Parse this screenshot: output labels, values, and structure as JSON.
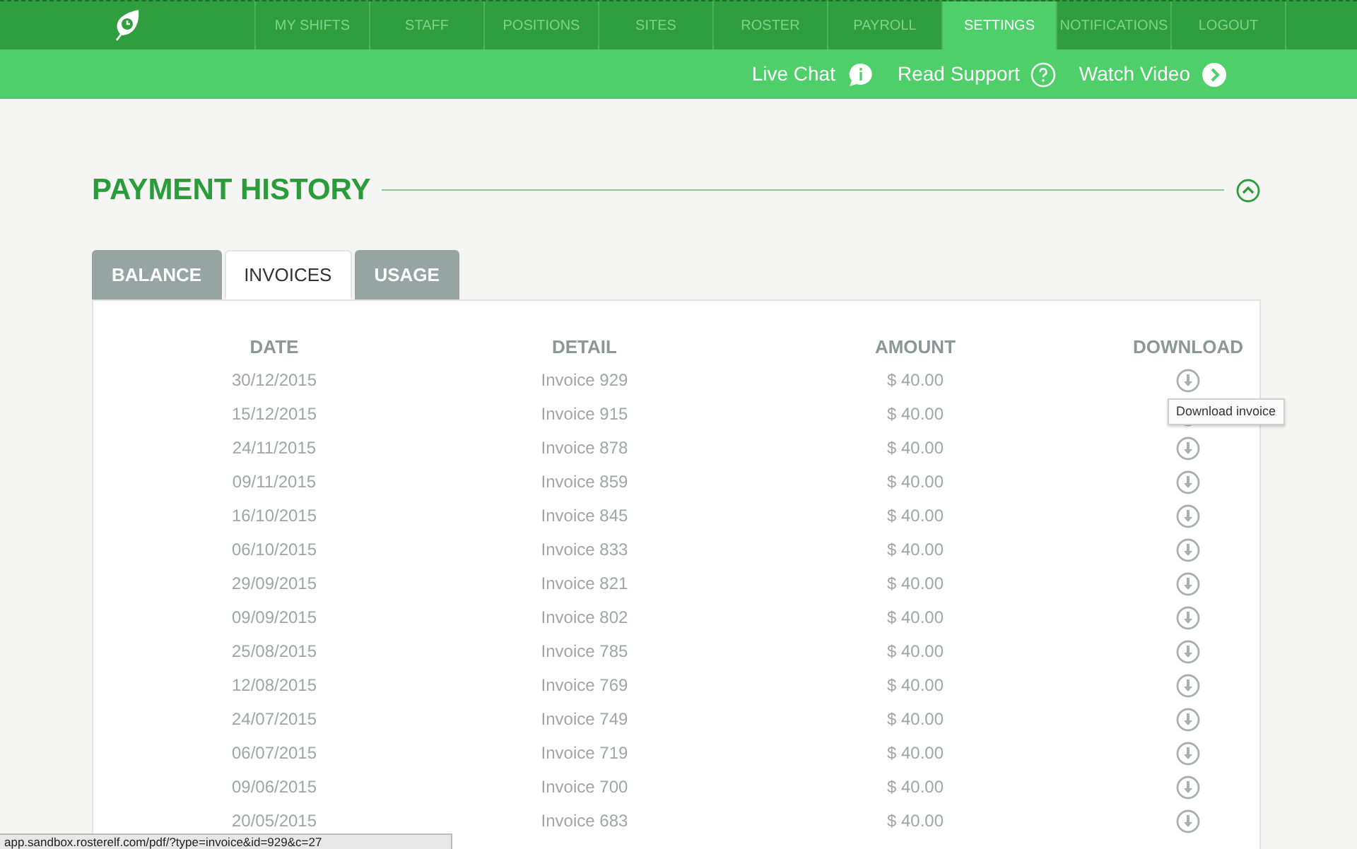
{
  "nav": {
    "items": [
      {
        "label": "MY SHIFTS",
        "selected": false
      },
      {
        "label": "STAFF",
        "selected": false
      },
      {
        "label": "POSITIONS",
        "selected": false
      },
      {
        "label": "SITES",
        "selected": false
      },
      {
        "label": "ROSTER",
        "selected": false
      },
      {
        "label": "PAYROLL",
        "selected": false
      },
      {
        "label": "SETTINGS",
        "selected": true
      },
      {
        "label": "NOTIFICATIONS",
        "selected": false
      },
      {
        "label": "LOGOUT",
        "selected": false
      }
    ]
  },
  "help_links": [
    {
      "label": "Live Chat",
      "kind": "chat"
    },
    {
      "label": "Read Support",
      "kind": "question"
    },
    {
      "label": "Watch Video",
      "kind": "play"
    }
  ],
  "section": {
    "title": "PAYMENT HISTORY",
    "expanded": true
  },
  "tabs": [
    {
      "label": "BALANCE",
      "selected": false
    },
    {
      "label": "INVOICES",
      "selected": true
    },
    {
      "label": "USAGE",
      "selected": false
    }
  ],
  "table": {
    "columns": [
      "DATE",
      "DETAIL",
      "AMOUNT",
      "DOWNLOAD"
    ],
    "rows": [
      {
        "date": "30/12/2015",
        "detail": "Invoice 929",
        "amount": "$ 40.00"
      },
      {
        "date": "15/12/2015",
        "detail": "Invoice 915",
        "amount": "$ 40.00",
        "tooltip": "Download invoice"
      },
      {
        "date": "24/11/2015",
        "detail": "Invoice 878",
        "amount": "$ 40.00"
      },
      {
        "date": "09/11/2015",
        "detail": "Invoice 859",
        "amount": "$ 40.00"
      },
      {
        "date": "16/10/2015",
        "detail": "Invoice 845",
        "amount": "$ 40.00"
      },
      {
        "date": "06/10/2015",
        "detail": "Invoice 833",
        "amount": "$ 40.00"
      },
      {
        "date": "29/09/2015",
        "detail": "Invoice 821",
        "amount": "$ 40.00"
      },
      {
        "date": "09/09/2015",
        "detail": "Invoice 802",
        "amount": "$ 40.00"
      },
      {
        "date": "25/08/2015",
        "detail": "Invoice 785",
        "amount": "$ 40.00"
      },
      {
        "date": "12/08/2015",
        "detail": "Invoice 769",
        "amount": "$ 40.00"
      },
      {
        "date": "24/07/2015",
        "detail": "Invoice 749",
        "amount": "$ 40.00"
      },
      {
        "date": "06/07/2015",
        "detail": "Invoice 719",
        "amount": "$ 40.00"
      },
      {
        "date": "09/06/2015",
        "detail": "Invoice 700",
        "amount": "$ 40.00"
      },
      {
        "date": "20/05/2015",
        "detail": "Invoice 683",
        "amount": "$ 40.00"
      }
    ]
  },
  "status_bar": {
    "url": "app.sandbox.rosterelf.com/pdf/?type=invoice&id=929&c=27"
  }
}
